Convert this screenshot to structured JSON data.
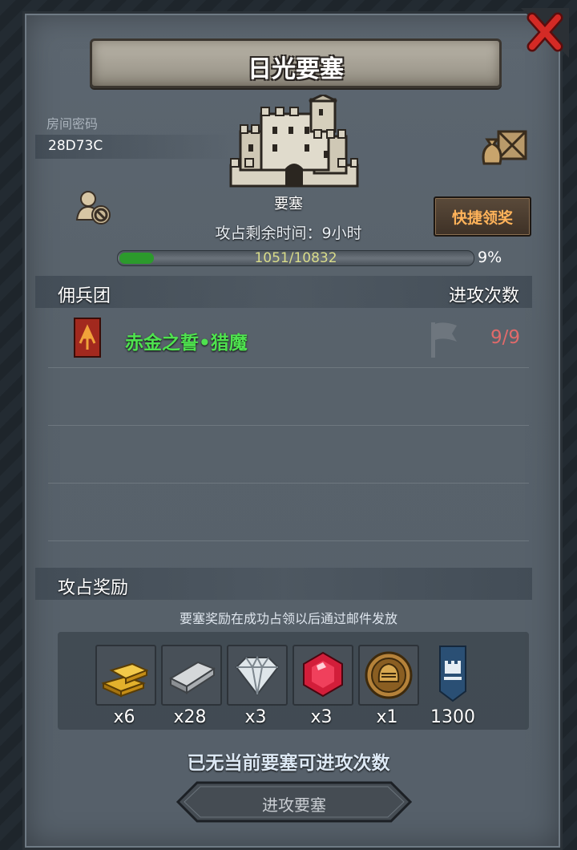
{
  "title": "日光要塞",
  "room": {
    "label": "房间密码",
    "code": "28D73C"
  },
  "fortress": {
    "name": "要塞",
    "timer_text": "攻占剩余时间：9小时"
  },
  "progress": {
    "text": "1051/10832",
    "current": 1051,
    "total": 10832,
    "percent_text": "9%"
  },
  "quick_button": "快捷领奖",
  "mercenary": {
    "header_left": "佣兵团",
    "header_right": "进攻次数",
    "rows": [
      {
        "name": "赤金之誓•猎魔",
        "count": "9/9"
      }
    ]
  },
  "rewards": {
    "header": "攻占奖励",
    "note": "要塞奖励在成功占领以后通过邮件发放",
    "items": [
      {
        "icon": "gold-bar-icon",
        "qty": "x6"
      },
      {
        "icon": "silver-bar-icon",
        "qty": "x28"
      },
      {
        "icon": "diamond-icon",
        "qty": "x3"
      },
      {
        "icon": "ruby-icon",
        "qty": "x3"
      },
      {
        "icon": "helmet-medal-icon",
        "qty": "x1"
      },
      {
        "icon": "fortress-banner-icon",
        "qty": "1300"
      }
    ]
  },
  "status_text": "已无当前要塞可进攻次数",
  "attack_button": "进攻要塞",
  "colors": {
    "progress_fill": "#2c9a2c",
    "merc_name": "#4fe24f",
    "attack_count": "#e06a6a",
    "quick_text": "#ffb35a"
  }
}
